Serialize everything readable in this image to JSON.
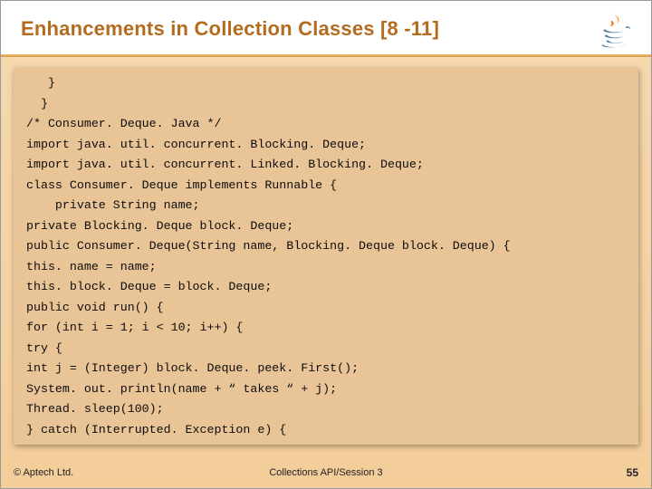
{
  "header": {
    "title": "Enhancements in Collection Classes [8 -11]",
    "logo_name": "java-logo"
  },
  "code": {
    "lines": [
      "   }",
      "  }",
      "/* Consumer. Deque. Java */",
      "import java. util. concurrent. Blocking. Deque;",
      "import java. util. concurrent. Linked. Blocking. Deque;",
      "class Consumer. Deque implements Runnable {",
      "    private String name;",
      "private Blocking. Deque block. Deque;",
      "public Consumer. Deque(String name, Blocking. Deque block. Deque) {",
      "this. name = name;",
      "this. block. Deque = block. Deque;",
      "public void run() {",
      "for (int i = 1; i < 10; i++) {",
      "try {",
      "int j = (Integer) block. Deque. peek. First();",
      "System. out. println(name + “ takes “ + j);",
      "Thread. sleep(100);",
      "} catch (Interrupted. Exception e) {"
    ]
  },
  "footer": {
    "copyright": "© Aptech Ltd.",
    "center": "Collections API/Session 3",
    "page": "55"
  }
}
